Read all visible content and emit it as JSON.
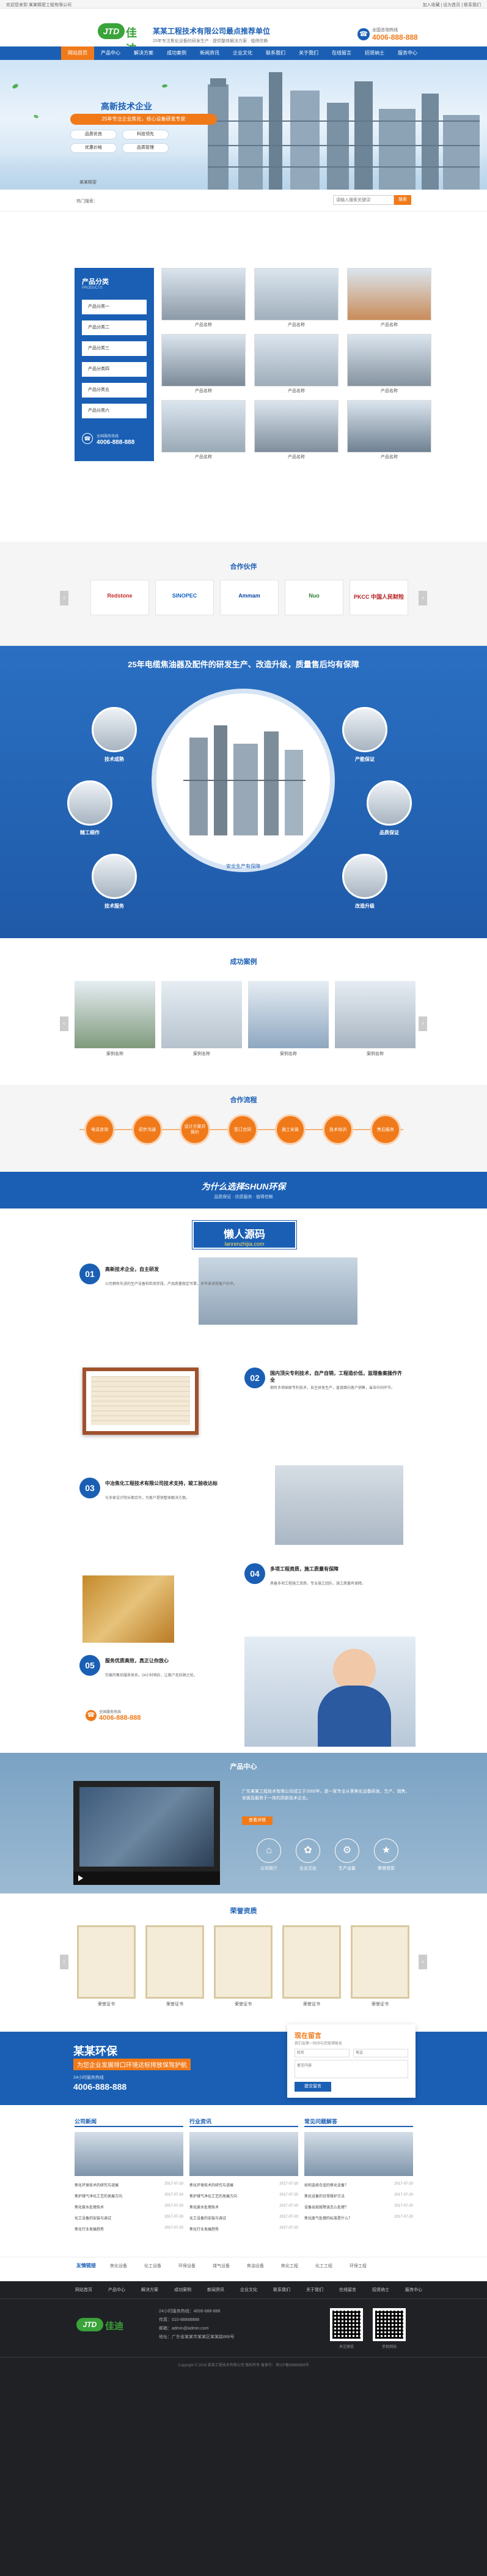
{
  "topbar": {
    "left": "欢迎您来到 某某精密工程有限公司",
    "right": "加入收藏 | 设为首页 | 联系我们"
  },
  "header": {
    "logo_mark": "JTD",
    "logo_cn": "佳迪",
    "brand_title": "某某工程技术有限公司最点推荐单位",
    "brand_sub": "25年专注焦化设备的研发生产 · 提供整体解决方案 · 值得信赖",
    "hotline_label": "全国咨询热线",
    "hotline_number": "4006-888-888"
  },
  "nav": [
    "网站首页",
    "产品中心",
    "解决方案",
    "成功案例",
    "新闻资讯",
    "企业文化",
    "联系我们",
    "关于我们",
    "在线留言",
    "招贤纳士",
    "服务中心"
  ],
  "banner": {
    "headline": "高新技术企业",
    "ribbon": "25年专注企业焦化，核心设备研发专家",
    "buttons": [
      "品质优良",
      "科技领先",
      "优惠价格",
      "品质管理"
    ],
    "tagline": "某某精密"
  },
  "search": {
    "hot_label": "热门搜索：",
    "placeholder": "请输入搜索关键词",
    "button": "搜索"
  },
  "products": {
    "title": "产品分类",
    "subtitle": "PRODUCTS",
    "categories": [
      "产品分类一",
      "产品分类二",
      "产品分类三",
      "产品分类四",
      "产品分类五",
      "产品分类六"
    ],
    "hotline_label": "全国服务热线",
    "hotline_number": "4006-888-888",
    "items": [
      "产品名称",
      "产品名称",
      "产品名称",
      "产品名称",
      "产品名称",
      "产品名称",
      "产品名称",
      "产品名称",
      "产品名称"
    ]
  },
  "partners": {
    "title": "合作伙伴",
    "logos": [
      "Redstone",
      "SINOPEC",
      "Ammam",
      "Nuo",
      "PKCC 中国人民财险"
    ]
  },
  "advantages": {
    "headline": "25年电缆焦油器及配件的研发生产、改造升级，质量售后均有保障",
    "items": [
      "技术成熟",
      "产能保证",
      "精工细作",
      "品质保证",
      "技术服务",
      "改造升级"
    ],
    "center_label": "安全生产有保障"
  },
  "cases": {
    "title": "成功案例",
    "items": [
      "案例名称",
      "案例名称",
      "案例名称",
      "案例名称",
      "案例名称"
    ]
  },
  "process": {
    "title": "合作流程",
    "steps": [
      "电话咨询",
      "初步沟通",
      "设计方案并报价",
      "签订合同",
      "施工安装",
      "技术培训",
      "售后服务"
    ]
  },
  "why": {
    "headline": "为什么选择SHUN环保",
    "sub": "品质保证 · 优质服务 · 值得信赖",
    "watermark": "懒人源码",
    "watermark_url": "lanrenzhijia.com",
    "points": [
      {
        "num": "01",
        "title": "高新技术企业，自主研发",
        "desc": "公司拥有先进的生产设备和检测手段，产品质量稳定可靠，多年来深受客户好评。"
      },
      {
        "num": "02",
        "title": "国内顶尖专利技术，自产自销，工程造价低，监理备案操作齐全",
        "desc": "拥有多项国家专利技术，自主研发生产，直接面向客户销售，省去中间环节。"
      },
      {
        "num": "03",
        "title": "中冶焦化工程技术有限公司技术支持，竣工验收达标",
        "desc": "与多家设计院长期合作，为客户提供整体解决方案。"
      },
      {
        "num": "04",
        "title": "多项工程资质，施工质量有保障",
        "desc": "具备多项工程施工资质，专业施工团队，施工质量有保障。"
      },
      {
        "num": "05",
        "title": "服务优质高效，真正让你放心",
        "desc": "完善的售后服务体系，24小时响应，让客户无后顾之忧。"
      }
    ],
    "hotline_label": "全国服务热线",
    "hotline_number": "4006-888-888"
  },
  "product_center": {
    "title": "产品中心",
    "desc": "广东某某工程技术有限公司成立于2000年，是一家专业从事焦化设备研发、生产、销售、安装及服务于一体的高新技术企业。",
    "more": "查看详情",
    "icons": [
      "公司简介",
      "企业文化",
      "生产设备",
      "荣誉资质"
    ]
  },
  "honors": {
    "title": "荣誉资质",
    "items": [
      "荣誉证书",
      "荣誉证书",
      "荣誉证书",
      "荣誉证书",
      "荣誉证书"
    ]
  },
  "contact_band": {
    "brand": "某某环保",
    "slogan": "为您企业发展排口环境达标排放保驾护航",
    "line1": "24小时服务热线",
    "phone": "4006-888-888",
    "form_title": "现在留言",
    "form_sub": "我们会第一时间与您取得联系",
    "name_ph": "姓名",
    "phone_ph": "电话",
    "content_ph": "留言内容",
    "submit": "提交留言"
  },
  "news": {
    "cols": [
      {
        "title": "公司新闻",
        "list": [
          "焦化环保技术的研究与进展",
          "焦炉煤气净化工艺的发展方向",
          "焦化废水处理技术",
          "化工设备的安装与调试",
          "焦化行业发展趋势"
        ]
      },
      {
        "title": "行业资讯",
        "list": [
          "焦化环保技术的研究与进展",
          "焦炉煤气净化工艺的发展方向",
          "焦化废水处理技术",
          "化工设备的安装与调试",
          "焦化行业发展趋势"
        ]
      },
      {
        "title": "常见问题解答",
        "list": [
          "如何选择合适的焦化设备？",
          "焦化设备的日常维护方法",
          "设备出现故障该怎么处理？",
          "焦化废气处理的标准是什么？"
        ]
      }
    ],
    "date": "2017-07-20"
  },
  "links": {
    "label": "友情链接",
    "items": [
      "焦化设备",
      "化工设备",
      "环保设备",
      "煤气设备",
      "焦油设备",
      "焦化工程",
      "化工工程",
      "环保工程"
    ]
  },
  "footer": {
    "nav": [
      "网站首页",
      "产品中心",
      "解决方案",
      "成功案例",
      "新闻资讯",
      "企业文化",
      "联系我们",
      "关于我们",
      "在线留言",
      "招贤纳士",
      "服务中心"
    ],
    "info": [
      "24小时服务热线：4006-888-888",
      "传真：010-88888888",
      "邮箱：admin@admin.com",
      "地址：广东省某某市某某区某某路888号"
    ],
    "qr1": "关注微信",
    "qr2": "手机网站",
    "copyright": "Copyright © 2018 某某工程技术有限公司 版权所有 备案号：粤ICP备88888888号"
  },
  "colors": {
    "primary": "#1a5fb4",
    "accent": "#f07a1a",
    "dark": "#222"
  }
}
